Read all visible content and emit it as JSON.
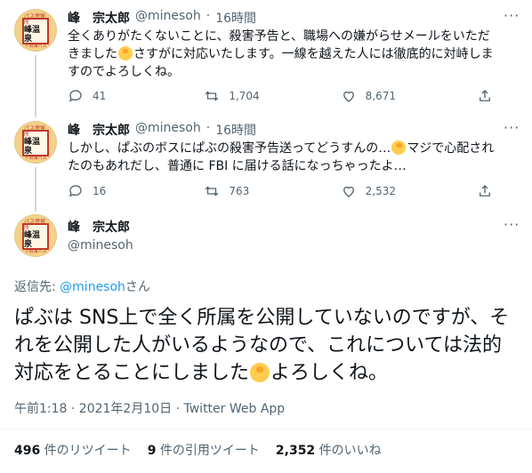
{
  "tweets": [
    {
      "name": "峰　宗太郎",
      "handle": "@minesoh",
      "dot": "·",
      "time": "16時間",
      "text_a": "全くありがたくないことに、殺害予告と、職場への嫌がらせメールをいただきました",
      "text_b": "さすがに対応いたします。一線を越えた人には徹底的に対峙しますのでよろしくね。",
      "replies": "41",
      "retweets": "1,704",
      "likes": "8,671"
    },
    {
      "name": "峰　宗太郎",
      "handle": "@minesoh",
      "dot": "·",
      "time": "16時間",
      "text_a": "しかし、ぱぶのボスにぱぶの殺害予告送ってどうすんの…",
      "text_b": "マジで心配されたのもあれだし、普通に FBI に届ける話になっちゃったよ…",
      "replies": "16",
      "retweets": "763",
      "likes": "2,532"
    }
  ],
  "main_tweet": {
    "name": "峰　宗太郎",
    "handle": "@minesoh",
    "reply_to_prefix": "返信先: ",
    "reply_to_handle": "@minesoh",
    "reply_to_suffix": "さん",
    "text_a": "ぱぶは SNS上で全く所属を公開していないのですが、それを公開した人がいるようなので、これについては法的対応をとることにしました",
    "text_b": "よろしくね。",
    "timestamp": "午前1:18 · 2021年2月10日 · Twitter Web App",
    "stats": {
      "retweets_num": "496",
      "retweets_label": " 件のリツイート",
      "quotes_num": "9",
      "quotes_label": " 件の引用ツイート",
      "likes_num": "2,352",
      "likes_label": " 件のいいね"
    }
  },
  "avatar": {
    "row1": "パス停留所",
    "row2": "峰温泉",
    "row3": "下田海バス"
  },
  "icons": [
    "reply-icon",
    "retweet-icon",
    "like-icon",
    "share-icon",
    "more-icon",
    "face-emoji-icon"
  ]
}
